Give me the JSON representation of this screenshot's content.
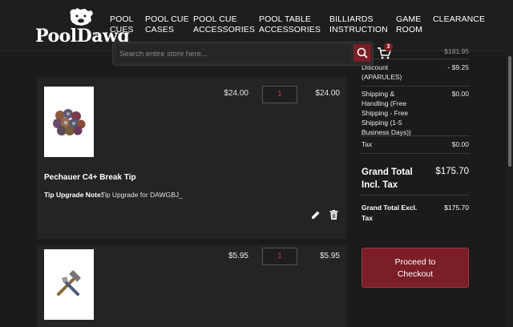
{
  "brand": {
    "name": "PoolDawg",
    "tm": "®"
  },
  "nav": [
    {
      "label": "POOL\nCUES"
    },
    {
      "label": "POOL CUE\nCASES"
    },
    {
      "label": "POOL CUE\nACCESSORIES"
    },
    {
      "label": "POOL TABLE\nACCESSORIES"
    },
    {
      "label": "BILLIARDS\nINSTRUCTION"
    },
    {
      "label": "GAME\nROOM"
    },
    {
      "label": "CLEARANCE"
    }
  ],
  "search": {
    "placeholder": "Search entire store here...",
    "icon": "search-icon"
  },
  "cart": {
    "count": "3",
    "icon": "cart-icon"
  },
  "items": [
    {
      "name": "Pechauer C4+ Break Tip",
      "price": "$24.00",
      "qty": "1",
      "subtotal": "$24.00",
      "option_label": "Tip Upgrade Note:",
      "option_value": "Tip Upgrade for DAWGBJ_",
      "image": "break-tips-image"
    },
    {
      "price": "$5.95",
      "qty": "1",
      "subtotal": "$5.95",
      "image": "tool-image"
    }
  ],
  "summary": {
    "cut_value": "$181.95",
    "discount_label": "Discount\n(APARULES)",
    "discount_value": "- $9.25",
    "shipping_label": "Shipping &\nHandling (Free\nShipping - Free\nShipping (1-5\nBusiness Days))",
    "shipping_value": "$0.00",
    "tax_label": "Tax",
    "tax_value": "$0.00",
    "grand_incl_label": "Grand Total\nIncl. Tax",
    "grand_incl_value": "$175.70",
    "grand_excl_label": "Grand Total Excl.\nTax",
    "grand_excl_value": "$175.70"
  },
  "checkout": {
    "label": "Proceed to\nCheckout"
  },
  "colors": {
    "accent": "#7b1e26",
    "background": "#1b1b1b",
    "card": "#242424",
    "qty_text": "#c43a48"
  }
}
